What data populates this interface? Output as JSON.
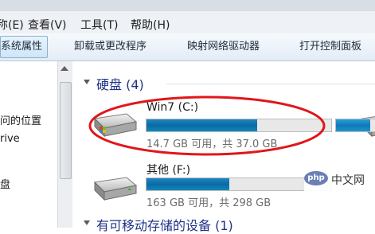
{
  "menubar": {
    "items": [
      "称(E)",
      "查看(V)",
      "工具(T)",
      "帮助(H)"
    ]
  },
  "toolbar": {
    "items": [
      "系统属性",
      "卸载或更改程序",
      "映射网络驱动器",
      "打开控制面板"
    ]
  },
  "left_pane": {
    "items": [
      "问的位置",
      "rive",
      "盘"
    ]
  },
  "main": {
    "hard_disk_group": "硬盘 (4)",
    "removable_group": "有可移动存储的设备 (1)",
    "drives": [
      {
        "name": "Win7 (C:)",
        "size_text": "14.7 GB 可用，共 37.0 GB",
        "used_fraction": 0.6
      },
      {
        "name": "其他 (F:)",
        "size_text": "163 GB 可用，共 298 GB",
        "used_fraction": 0.45
      },
      {
        "used_fraction": 0.72
      }
    ]
  },
  "watermark": {
    "logo": "php",
    "text": "中文网"
  },
  "colors": {
    "accent_blue": "#1e3287",
    "bar_fill": "#0b6aa6",
    "annotation_red": "#e0161b"
  }
}
